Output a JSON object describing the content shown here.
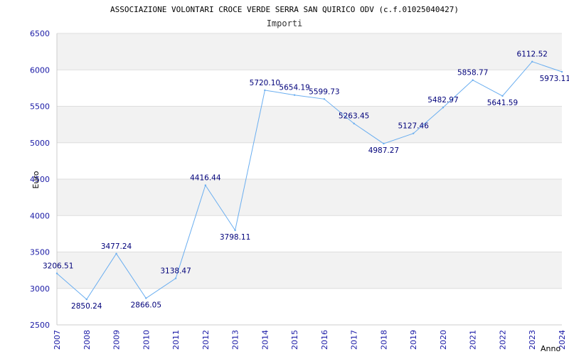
{
  "chart_data": {
    "type": "line",
    "title": "ASSOCIAZIONE VOLONTARI CROCE VERDE SERRA SAN QUIRICO ODV (c.f.01025040427)",
    "subtitle": "Importi",
    "xlabel": "Anno",
    "ylabel": "Euro",
    "ylim": [
      2500,
      6500
    ],
    "yticks": [
      2500,
      3000,
      3500,
      4000,
      4500,
      5000,
      5500,
      6000,
      6500
    ],
    "grid": true,
    "x": [
      "2007",
      "2008",
      "2009",
      "2010",
      "2011",
      "2012",
      "2013",
      "2014",
      "2015",
      "2016",
      "2017",
      "2018",
      "2019",
      "2020",
      "2021",
      "2022",
      "2023",
      "2024"
    ],
    "values": [
      3206.51,
      2850.24,
      3477.24,
      2866.05,
      3138.47,
      4416.44,
      3798.11,
      5720.1,
      5654.19,
      5599.73,
      5263.45,
      4987.27,
      5127.46,
      5482.97,
      5858.77,
      5641.59,
      6112.52,
      5973.11
    ],
    "value_labels": [
      "3206.51",
      "2850.24",
      "3477.24",
      "2866.05",
      "3138.47",
      "4416.44",
      "3798.11",
      "5720.10",
      "5654.19",
      "5599.73",
      "5263.45",
      "4987.27",
      "5127.46",
      "5482.97",
      "5858.77",
      "5641.59",
      "6112.52",
      "5973.11"
    ],
    "colors": {
      "line": "#6aaef0",
      "axis_text": "#1a1aa6",
      "value_text": "#00007a",
      "band": "#f2f2f2",
      "grid": "#dddddd",
      "title_text": "#000000",
      "subtitle_text": "#333333"
    }
  }
}
